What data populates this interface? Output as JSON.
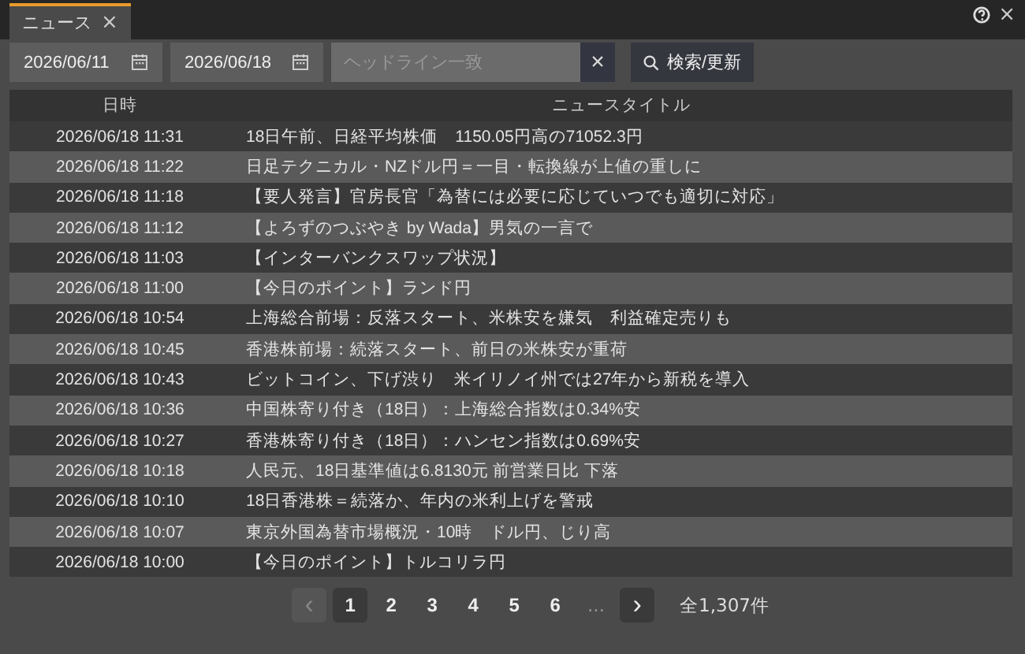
{
  "tabs": [
    {
      "label": "ニュース",
      "close": "×",
      "selected": true
    }
  ],
  "window_controls": {
    "close": "×"
  },
  "toolbar": {
    "date_from": "2026/06/11",
    "date_to": "2026/06/18",
    "search": {
      "placeholder": "ヘッドライン一致"
    },
    "clear": "×",
    "search_button": "検索/更新"
  },
  "table": {
    "columns": [
      "日時",
      "ニュースタイトル"
    ],
    "rows": [
      {
        "date": "2026/06/18 11:31",
        "title": "18日午前、日経平均株価　1150.05円高の71052.3円"
      },
      {
        "date": "2026/06/18 11:22",
        "title": "日足テクニカル・NZドル円＝一目・転換線が上値の重しに"
      },
      {
        "date": "2026/06/18 11:18",
        "title": "【要人発言】官房長官「為替には必要に応じていつでも適切に対応」"
      },
      {
        "date": "2026/06/18 11:12",
        "title": "【よろずのつぶやき by Wada】男気の一言で"
      },
      {
        "date": "2026/06/18 11:03",
        "title": "【インターバンクスワップ状況】"
      },
      {
        "date": "2026/06/18 11:00",
        "title": "【今日のポイント】ランド円"
      },
      {
        "date": "2026/06/18 10:54",
        "title": "上海総合前場：反落スタート、米株安を嫌気　利益確定売りも"
      },
      {
        "date": "2026/06/18 10:45",
        "title": "香港株前場：続落スタート、前日の米株安が重荷"
      },
      {
        "date": "2026/06/18 10:43",
        "title": "ビットコイン、下げ渋り　米イリノイ州では27年から新税を導入"
      },
      {
        "date": "2026/06/18 10:36",
        "title": "中国株寄り付き（18日）：上海総合指数は0.34%安"
      },
      {
        "date": "2026/06/18 10:27",
        "title": "香港株寄り付き（18日）：ハンセン指数は0.69%安"
      },
      {
        "date": "2026/06/18 10:18",
        "title": "人民元、18日基準値は6.8130元 前営業日比 下落"
      },
      {
        "date": "2026/06/18 10:10",
        "title": "18日香港株＝続落か、年内の米利上げを警戒"
      },
      {
        "date": "2026/06/18 10:07",
        "title": "東京外国為替市場概況・10時　ドル円、じり高"
      },
      {
        "date": "2026/06/18 10:00",
        "title": "【今日のポイント】トルコリラ円"
      }
    ]
  },
  "pagination": {
    "prev": {
      "label": "‹",
      "disabled": true
    },
    "pages": [
      {
        "label": "1",
        "selected": true
      },
      {
        "label": "2",
        "selected": false
      },
      {
        "label": "3",
        "selected": false
      },
      {
        "label": "4",
        "selected": false
      },
      {
        "label": "5",
        "selected": false
      },
      {
        "label": "6",
        "selected": false
      }
    ],
    "ellipsis": "…",
    "next": {
      "label": "›",
      "disabled": false
    },
    "total": "全1,307件"
  }
}
